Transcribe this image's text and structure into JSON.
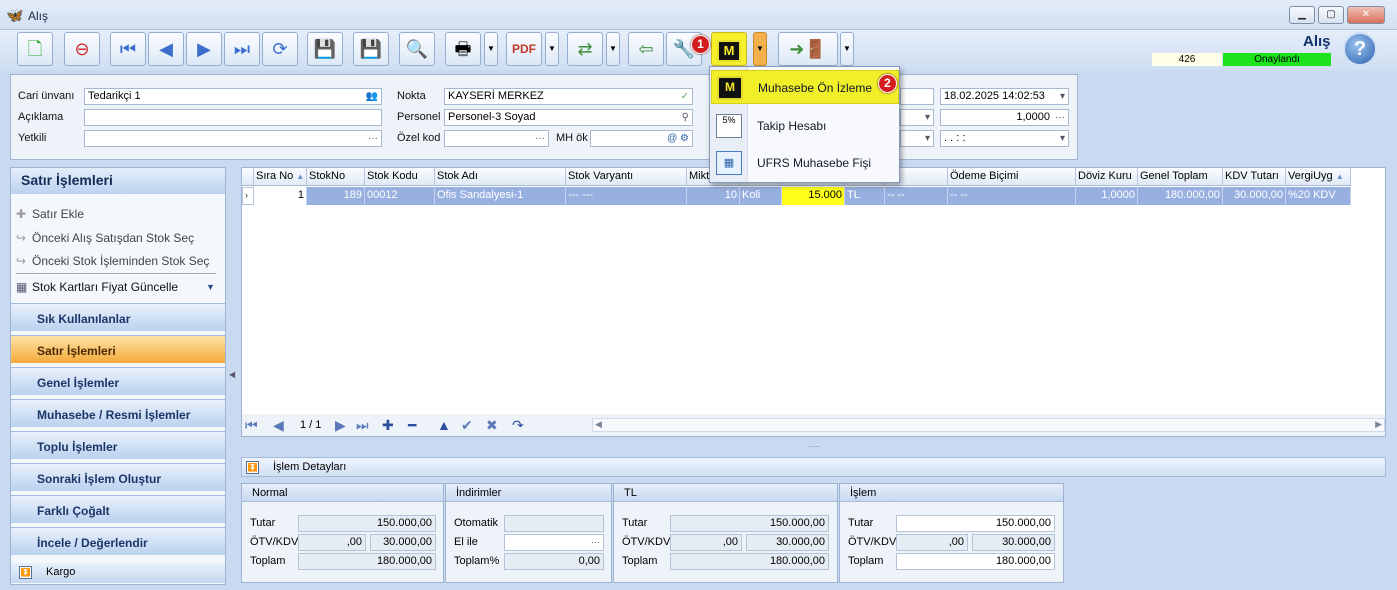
{
  "window": {
    "title": "Alış",
    "min": "▁",
    "max": "▢",
    "close": "✕"
  },
  "toolbar": {
    "header_title": "Alış",
    "status_number": "426",
    "status_text": "Onaylandı",
    "m_label": "M",
    "badge1": "1",
    "badge2": "2"
  },
  "header_fields": {
    "cari_unvani_label": "Cari ünvanı",
    "cari_unvani_value": "Tedarikçi 1",
    "aciklama_label": "Açıklama",
    "aciklama_value": "",
    "yetkili_label": "Yetkili",
    "yetkili_value": "",
    "nokta_label": "Nokta",
    "nokta_value": "KAYSERİ MERKEZ",
    "personel_label": "Personel",
    "personel_value": "Personel-3 Soyad",
    "ozel_kod_label": "Özel kod",
    "ozel_kod_value": "",
    "mh_ok_label": "MH ök",
    "mh_ok_value": "",
    "date_value": "18.02.2025 14:02:53",
    "rate_value": "1,0000",
    "time_value": ".   .        :   :"
  },
  "left_panel": {
    "title": "Satır İşlemleri",
    "items": [
      "Satır Ekle",
      "Önceki Alış Satışdan Stok Seç",
      "Önceki Stok İşleminden Stok Seç",
      "Stok Kartları Fiyat Güncelle"
    ],
    "nav": [
      "Sık Kullanılanlar",
      "Satır İşlemleri",
      "Genel İşlemler",
      "Muhasebe / Resmi İşlemler",
      "Toplu İşlemler",
      "Sonraki İşlem Oluştur",
      "Farklı Çoğalt",
      "İncele / Değerlendir"
    ],
    "kargo": "Kargo"
  },
  "grid": {
    "headers": [
      "Sıra No",
      "StokNo",
      "Stok Kodu",
      "Stok Adı",
      "Stok Varyantı",
      "Mikt",
      "",
      "",
      "",
      "",
      "Ödeme Biçimi",
      "Döviz Kuru",
      "Genel Toplam",
      "KDV Tutarı",
      "VergiUyg"
    ],
    "row": [
      "1",
      "189",
      "00012",
      "Ofis Sandalyesi-1",
      "--- ---",
      "10",
      "Koli",
      "15.000",
      "TL",
      "-- --",
      "-- --",
      "1,0000",
      "180.000,00",
      "30.000,00",
      "%20 KDV"
    ],
    "page": "1 / 1"
  },
  "details": {
    "bar_label": "İşlem Detayları",
    "normal": {
      "title": "Normal",
      "tutar_label": "Tutar",
      "tutar": "150.000,00",
      "otv_label": "ÖTV/KDV",
      "otv": ",00",
      "kdv": "30.000,00",
      "toplam_label": "Toplam",
      "toplam": "180.000,00"
    },
    "indirim": {
      "title": "İndirimler",
      "otomatik_label": "Otomatik",
      "otomatik": "",
      "elile_label": "El ile",
      "elile": "",
      "toplam_label": "Toplam%",
      "toplam": "0,00"
    },
    "tl": {
      "title": "TL",
      "tutar_label": "Tutar",
      "tutar": "150.000,00",
      "otv_label": "ÖTV/KDV",
      "otv": ",00",
      "kdv": "30.000,00",
      "toplam_label": "Toplam",
      "toplam": "180.000,00"
    },
    "islem": {
      "title": "İşlem",
      "tutar_label": "Tutar",
      "tutar": "150.000,00",
      "otv_label": "ÖTV/KDV",
      "otv": ",00",
      "kdv": "30.000,00",
      "toplam_label": "Toplam",
      "toplam": "180.000,00"
    }
  },
  "menu": {
    "items": [
      "Muhasebe Ön İzleme",
      "Takip Hesabı",
      "UFRS Muhasebe Fişi"
    ],
    "icons": {
      "m": "M",
      "t": "5%"
    }
  }
}
